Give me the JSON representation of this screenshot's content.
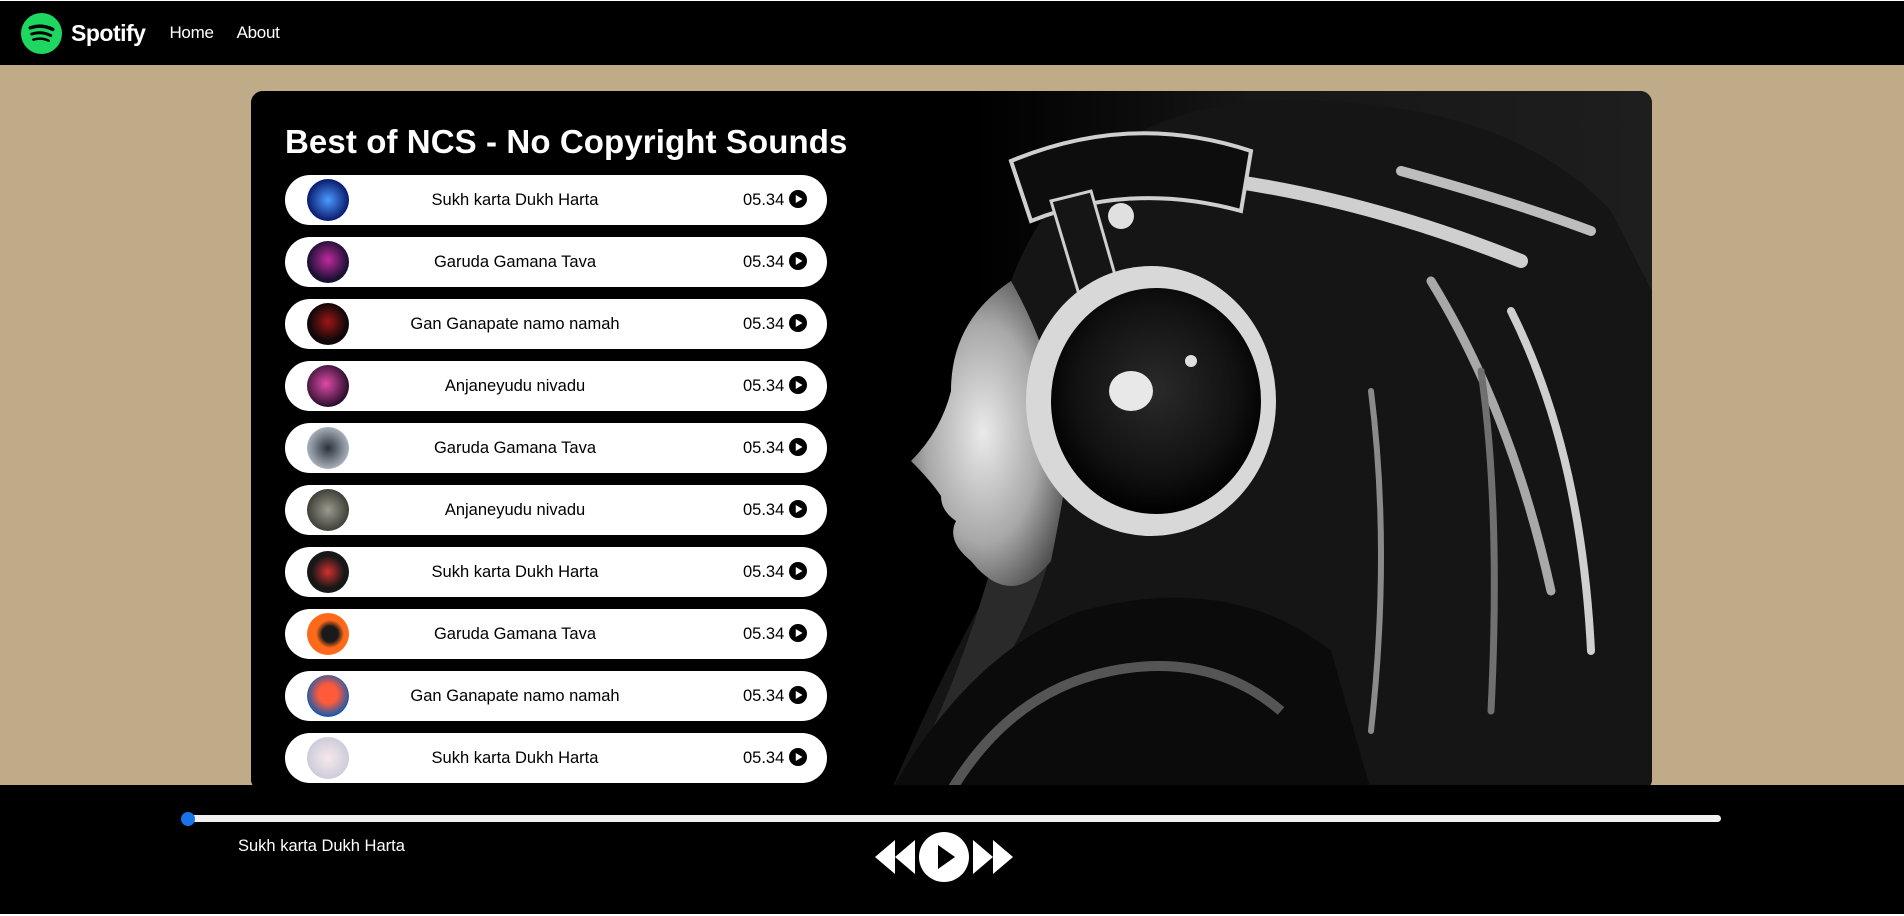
{
  "navbar": {
    "brand": "Spotify",
    "links": [
      "Home",
      "About"
    ],
    "logo_icon": "spotify-logo-icon",
    "logo_color": "#1ed760"
  },
  "main": {
    "title": "Best of NCS - No Copyright Sounds",
    "hero_image": "woman-wearing-headphones-photo",
    "songs": [
      {
        "name": "Sukh karta Dukh Harta",
        "duration": "05.34",
        "cover_colors": [
          "#4a9cff",
          "#0b1a6e"
        ]
      },
      {
        "name": "Garuda Gamana Tava",
        "duration": "05.34",
        "cover_colors": [
          "#c22a9e",
          "#1a1034"
        ]
      },
      {
        "name": "Gan Ganapate namo namah",
        "duration": "05.34",
        "cover_colors": [
          "#a01515",
          "#100808"
        ]
      },
      {
        "name": "Anjaneyudu nivadu",
        "duration": "05.34",
        "cover_colors": [
          "#e04aa8",
          "#2a0f2e"
        ]
      },
      {
        "name": "Garuda Gamana Tava",
        "duration": "05.34",
        "cover_colors": [
          "#b8c2cc",
          "#2c3038"
        ]
      },
      {
        "name": "Anjaneyudu nivadu",
        "duration": "05.34",
        "cover_colors": [
          "#9a9a8e",
          "#3a3a34"
        ]
      },
      {
        "name": "Sukh karta Dukh Harta",
        "duration": "05.34",
        "cover_colors": [
          "#d43030",
          "#171717"
        ]
      },
      {
        "name": "Garuda Gamana Tava",
        "duration": "05.34",
        "cover_colors": [
          "#ff6a1a",
          "#1a1a1a"
        ]
      },
      {
        "name": "Gan Ganapate namo namah",
        "duration": "05.34",
        "cover_colors": [
          "#ff5a3a",
          "#1f5aa8"
        ]
      },
      {
        "name": "Sukh karta Dukh Harta",
        "duration": "05.34",
        "cover_colors": [
          "#f7e8ec",
          "#c8c8d8"
        ]
      }
    ]
  },
  "player": {
    "now_playing": "Sukh karta Dukh Harta",
    "progress": 0,
    "accent_color": "#1a73e8",
    "controls": [
      "previous-icon",
      "play-icon",
      "next-icon"
    ]
  }
}
